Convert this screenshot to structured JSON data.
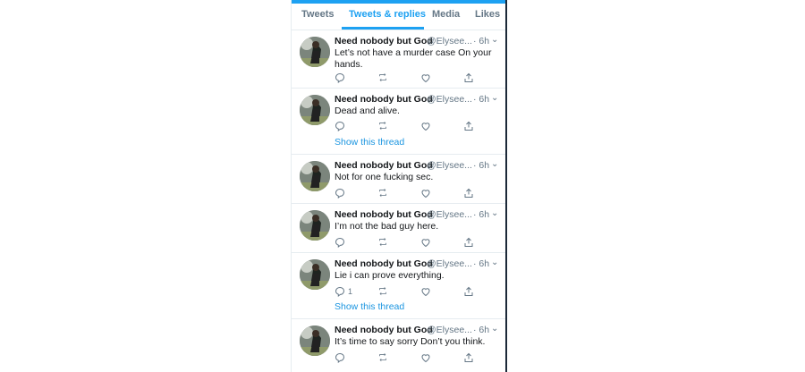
{
  "tabs": [
    {
      "label": "Tweets",
      "active": false
    },
    {
      "label": "Tweets & replies",
      "active": true
    },
    {
      "label": "Media",
      "active": false
    },
    {
      "label": "Likes",
      "active": false
    }
  ],
  "accent_color": "#1da1f2",
  "tweets": [
    {
      "name": "Need nobody but God",
      "handle": "@Elysee...",
      "time": "· 6h",
      "text": "Let’s not have a murder case On your hands.",
      "reply_count": "",
      "show_thread": ""
    },
    {
      "name": "Need nobody but God",
      "handle": "@Elysee...",
      "time": "· 6h",
      "text": "Dead and alive.",
      "reply_count": "",
      "show_thread": "Show this thread"
    },
    {
      "name": "Need nobody but God",
      "handle": "@Elysee...",
      "time": "· 6h",
      "text": "Not for one fucking sec.",
      "reply_count": "",
      "show_thread": ""
    },
    {
      "name": "Need nobody but God",
      "handle": "@Elysee...",
      "time": "· 6h",
      "text": "I’m not the bad guy here.",
      "reply_count": "",
      "show_thread": ""
    },
    {
      "name": "Need nobody but God",
      "handle": "@Elysee...",
      "time": "· 6h",
      "text": "Lie i can prove everything.",
      "reply_count": "1",
      "show_thread": "Show this thread"
    },
    {
      "name": "Need nobody but God",
      "handle": "@Elysee...",
      "time": "· 6h",
      "text": "It’s time to say sorry Don’t you think.",
      "reply_count": "",
      "show_thread": ""
    }
  ]
}
